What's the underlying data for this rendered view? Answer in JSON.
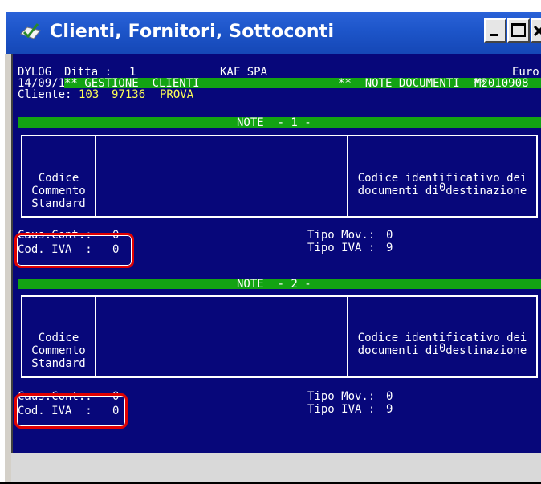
{
  "window": {
    "title": "Clienti, Fornitori, Sottoconti",
    "minimize_label": "_",
    "close_label": "×"
  },
  "header": {
    "app": "DYLOG",
    "date": "14/09/11",
    "ditta_label": "Ditta :",
    "ditta_num": "1",
    "ditta_name": "KAF SPA",
    "currency": "Euro",
    "section_left": "** GESTIONE  CLIENTI",
    "section_right": "**  NOTE DOCUMENTI  **",
    "code": "M2010908",
    "cliente_label": "Cliente:",
    "cliente_code": "103",
    "cliente_num": "97136",
    "cliente_name": "PROVA"
  },
  "note1": {
    "bar_label": "NOTE  - 1 -",
    "codice_lines": [
      "Codice",
      "Commento",
      "Standard"
    ],
    "dest_lines": [
      "Codice identificativo dei",
      "documenti di destinazione"
    ],
    "dest_value": "0",
    "caus_label": "Caus.Cont.:",
    "caus_value": "0",
    "iva_label": "Cod. IVA  :",
    "iva_value": "0",
    "tipo_mov_label": "Tipo Mov.:",
    "tipo_mov_value": "0",
    "tipo_iva_label": "Tipo IVA :",
    "tipo_iva_value": "9"
  },
  "note2": {
    "bar_label": "NOTE  - 2 -",
    "codice_lines": [
      "Codice",
      "Commento",
      "Standard"
    ],
    "dest_lines": [
      "Codice identificativo dei",
      "documenti di destinazione"
    ],
    "dest_value": "0",
    "caus_label": "Caus.Cont.:",
    "caus_value": "0",
    "iva_label": "Cod. IVA  :",
    "iva_value": "0",
    "tipo_mov_label": "Tipo Mov.:",
    "tipo_mov_value": "0",
    "tipo_iva_label": "Tipo IVA :",
    "tipo_iva_value": "9"
  },
  "colors": {
    "console_bg": "#07077a",
    "green_bar": "#13a313",
    "highlight": "#e00000",
    "yellow_text": "#ffff55"
  },
  "icons": [
    "checkmark-window-icon",
    "minimize-icon",
    "maximize-icon",
    "close-icon"
  ]
}
